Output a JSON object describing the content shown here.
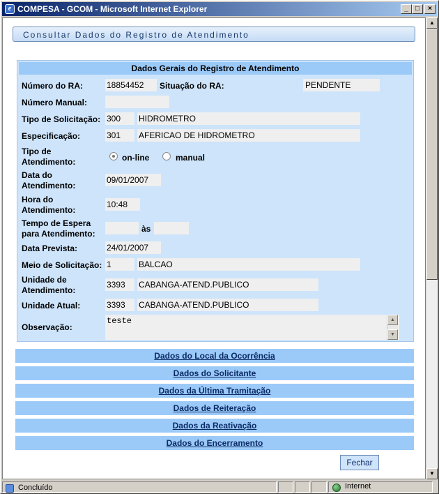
{
  "window": {
    "title": "COMPESA - GCOM - Microsoft Internet Explorer",
    "minimize": "_",
    "maximize": "□",
    "close": "×"
  },
  "page": {
    "header": "Consultar Dados do Registro de Atendimento"
  },
  "panel": {
    "title": "Dados Gerais do Registro de Atendimento",
    "numero_ra_label": "Número do RA:",
    "numero_ra_value": "18854452",
    "situacao_label": "Situação do RA:",
    "situacao_value": "PENDENTE",
    "numero_manual_label": "Número Manual:",
    "numero_manual_value": "",
    "tipo_solicitacao_label": "Tipo de Solicitação:",
    "tipo_solicitacao_code": "300",
    "tipo_solicitacao_desc": "HIDROMETRO",
    "especificacao_label": "Especificação:",
    "especificacao_code": "301",
    "especificacao_desc": "AFERICAO DE HIDROMETRO",
    "tipo_atendimento_label_1": "Tipo de",
    "tipo_atendimento_label_2": "Atendimento:",
    "tipo_atendimento_options": [
      "on-line",
      "manual"
    ],
    "tipo_atendimento_selected": "on-line",
    "data_atendimento_label_1": "Data do",
    "data_atendimento_label_2": "Atendimento:",
    "data_atendimento_value": "09/01/2007",
    "hora_atendimento_label_1": "Hora do",
    "hora_atendimento_label_2": "Atendimento:",
    "hora_atendimento_value": "10:48",
    "tempo_espera_label_1": "Tempo de Espera",
    "tempo_espera_label_2": "para Atendimento:",
    "tempo_espera_inicio": "",
    "tempo_espera_sep": "às",
    "tempo_espera_fim": "",
    "data_prevista_label": "Data Prevista:",
    "data_prevista_value": "24/01/2007",
    "meio_solicitacao_label": "Meio de Solicitação:",
    "meio_solicitacao_code": "1",
    "meio_solicitacao_desc": "BALCAO",
    "unidade_atendimento_label_1": "Unidade de",
    "unidade_atendimento_label_2": "Atendimento:",
    "unidade_atendimento_code": "3393",
    "unidade_atendimento_desc": "CABANGA-ATEND.PUBLICO",
    "unidade_atual_label": "Unidade Atual:",
    "unidade_atual_code": "3393",
    "unidade_atual_desc": "CABANGA-ATEND.PUBLICO",
    "observacao_label": "Observação:",
    "observacao_value": "teste"
  },
  "sections": [
    "Dados do Local da Ocorrência",
    "Dados do Solicitante",
    "Dados da Última Tramitação",
    "Dados de Reiteração",
    "Dados da Reativação",
    "Dados do Encerramento"
  ],
  "buttons": {
    "fechar": "Fechar"
  },
  "statusbar": {
    "status": "Concluído",
    "zone": "Internet"
  }
}
